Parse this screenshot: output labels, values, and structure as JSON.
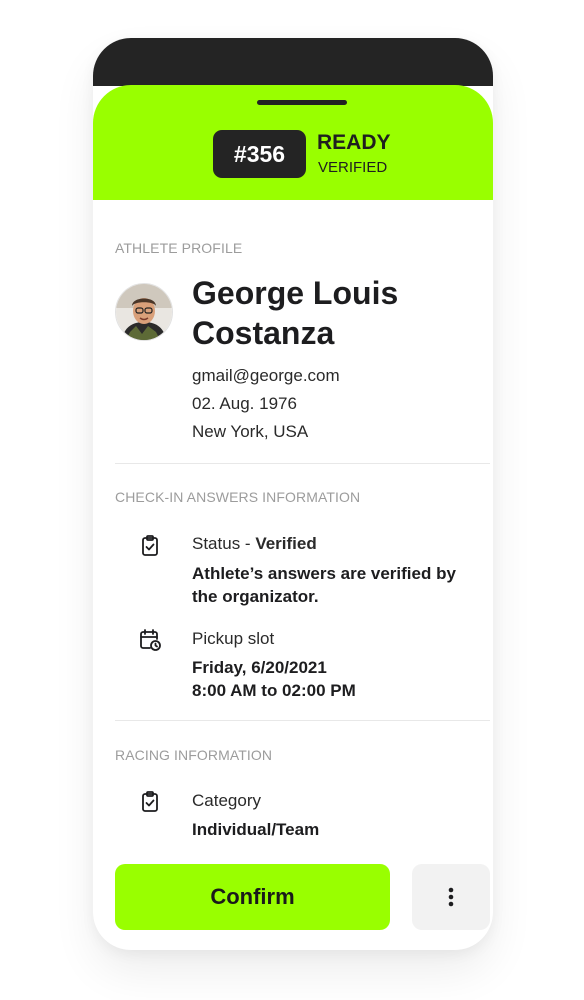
{
  "header": {
    "number": "#356",
    "status": "READY",
    "substatus": "VERIFIED"
  },
  "profile": {
    "section_label": "ATHLETE PROFILE",
    "name_line1": "George Louis",
    "name_line2": "Costanza",
    "email": "gmail@george.com",
    "birthdate": "02. Aug. 1976",
    "location": "New York, USA"
  },
  "checkin": {
    "section_label": "CHECK-IN ANSWERS INFORMATION",
    "status_prefix": "Status - ",
    "status_value": "Verified",
    "status_desc_line1": "Athlete’s answers are verified by",
    "status_desc_line2": "the organizator.",
    "pickup_label": "Pickup slot",
    "pickup_date": "Friday, 6/20/2021",
    "pickup_time": "8:00 AM to 02:00 PM"
  },
  "racing": {
    "section_label": "RACING INFORMATION",
    "category_label": "Category",
    "category_value": "Individual/Team"
  },
  "actions": {
    "confirm_label": "Confirm"
  },
  "colors": {
    "accent": "#99ff00",
    "dark": "#242424"
  },
  "icons": {
    "status": "clipboard-check-icon",
    "pickup": "calendar-clock-icon",
    "category": "clipboard-check-icon",
    "more": "more-vertical-icon"
  }
}
